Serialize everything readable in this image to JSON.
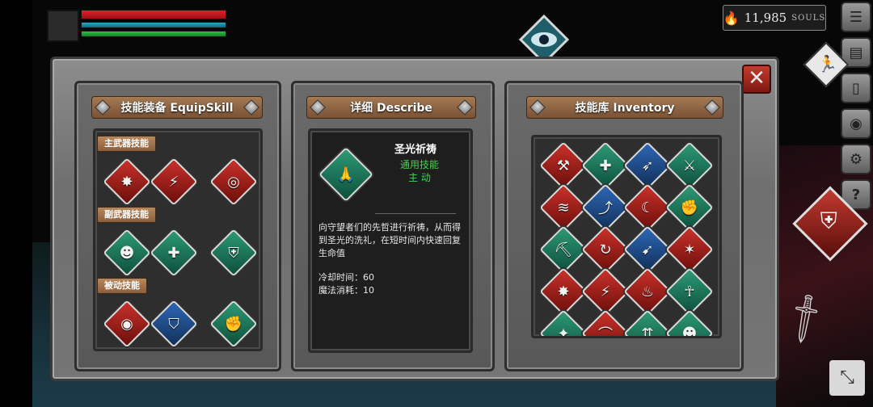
{
  "hud": {
    "souls_value": "11,985",
    "souls_unit": "SOULS"
  },
  "panels": {
    "equip": {
      "title": "技能装备 EquipSkill",
      "sections": [
        {
          "label": "主武器技能",
          "skills": [
            {
              "icon": "claw-burst-icon",
              "color": "red"
            },
            {
              "icon": "blade-slash-icon",
              "color": "red"
            },
            {
              "icon": "whirlwind-icon",
              "color": "red"
            }
          ]
        },
        {
          "label": "副武器技能",
          "skills": [
            {
              "icon": "mind-head-icon",
              "color": "green"
            },
            {
              "icon": "holy-shield-icon",
              "color": "green"
            },
            {
              "icon": "shield-buff-icon",
              "color": "green"
            }
          ]
        },
        {
          "label": "被动技能",
          "skills": [
            {
              "icon": "blood-eye-icon",
              "color": "red"
            },
            {
              "icon": "shield-icon",
              "color": "blue"
            },
            {
              "icon": "strength-arm-icon",
              "color": "green"
            }
          ]
        }
      ]
    },
    "describe": {
      "title": "详细 Describe",
      "skill_name": "圣光祈祷",
      "skill_type": "通用技能",
      "skill_mode": "主 动",
      "description": "向守望者们的先哲进行祈祷，从而得到圣光的洗礼，在短时间内快速回复生命值",
      "cooldown_label": "冷却时间：60",
      "mana_label": "魔法消耗：10"
    },
    "inventory": {
      "title": "技能库 Inventory",
      "grid": [
        {
          "icon": "anvil-icon",
          "color": "red"
        },
        {
          "icon": "holy-shield-icon",
          "color": "green"
        },
        {
          "icon": "dash-figure-icon",
          "color": "blue"
        },
        {
          "icon": "sword-up-icon",
          "color": "green"
        },
        {
          "icon": "wave-strike-icon",
          "color": "red"
        },
        {
          "icon": "leap-figure-icon",
          "color": "blue"
        },
        {
          "icon": "crescent-slash-icon",
          "color": "red"
        },
        {
          "icon": "fist-icon",
          "color": "green"
        },
        {
          "icon": "axe-icon",
          "color": "green"
        },
        {
          "icon": "spin-slash-icon",
          "color": "red"
        },
        {
          "icon": "wind-slash-icon",
          "color": "blue"
        },
        {
          "icon": "shatter-icon",
          "color": "red"
        },
        {
          "icon": "claw-burst-icon",
          "color": "red"
        },
        {
          "icon": "blade-slash-icon",
          "color": "red"
        },
        {
          "icon": "flame-icon",
          "color": "red"
        },
        {
          "icon": "pray-hands-icon",
          "color": "green"
        },
        {
          "icon": "flex-icon",
          "color": "green"
        },
        {
          "icon": "arc-slash-icon",
          "color": "red"
        },
        {
          "icon": "triple-arrow-icon",
          "color": "green"
        },
        {
          "icon": "mind-head-icon",
          "color": "green"
        }
      ]
    }
  },
  "side_menu": [
    "menu-list-icon",
    "scroll-map-icon",
    "door-icon",
    "gear-medal-icon",
    "settings-gear-icon",
    "help-icon"
  ]
}
